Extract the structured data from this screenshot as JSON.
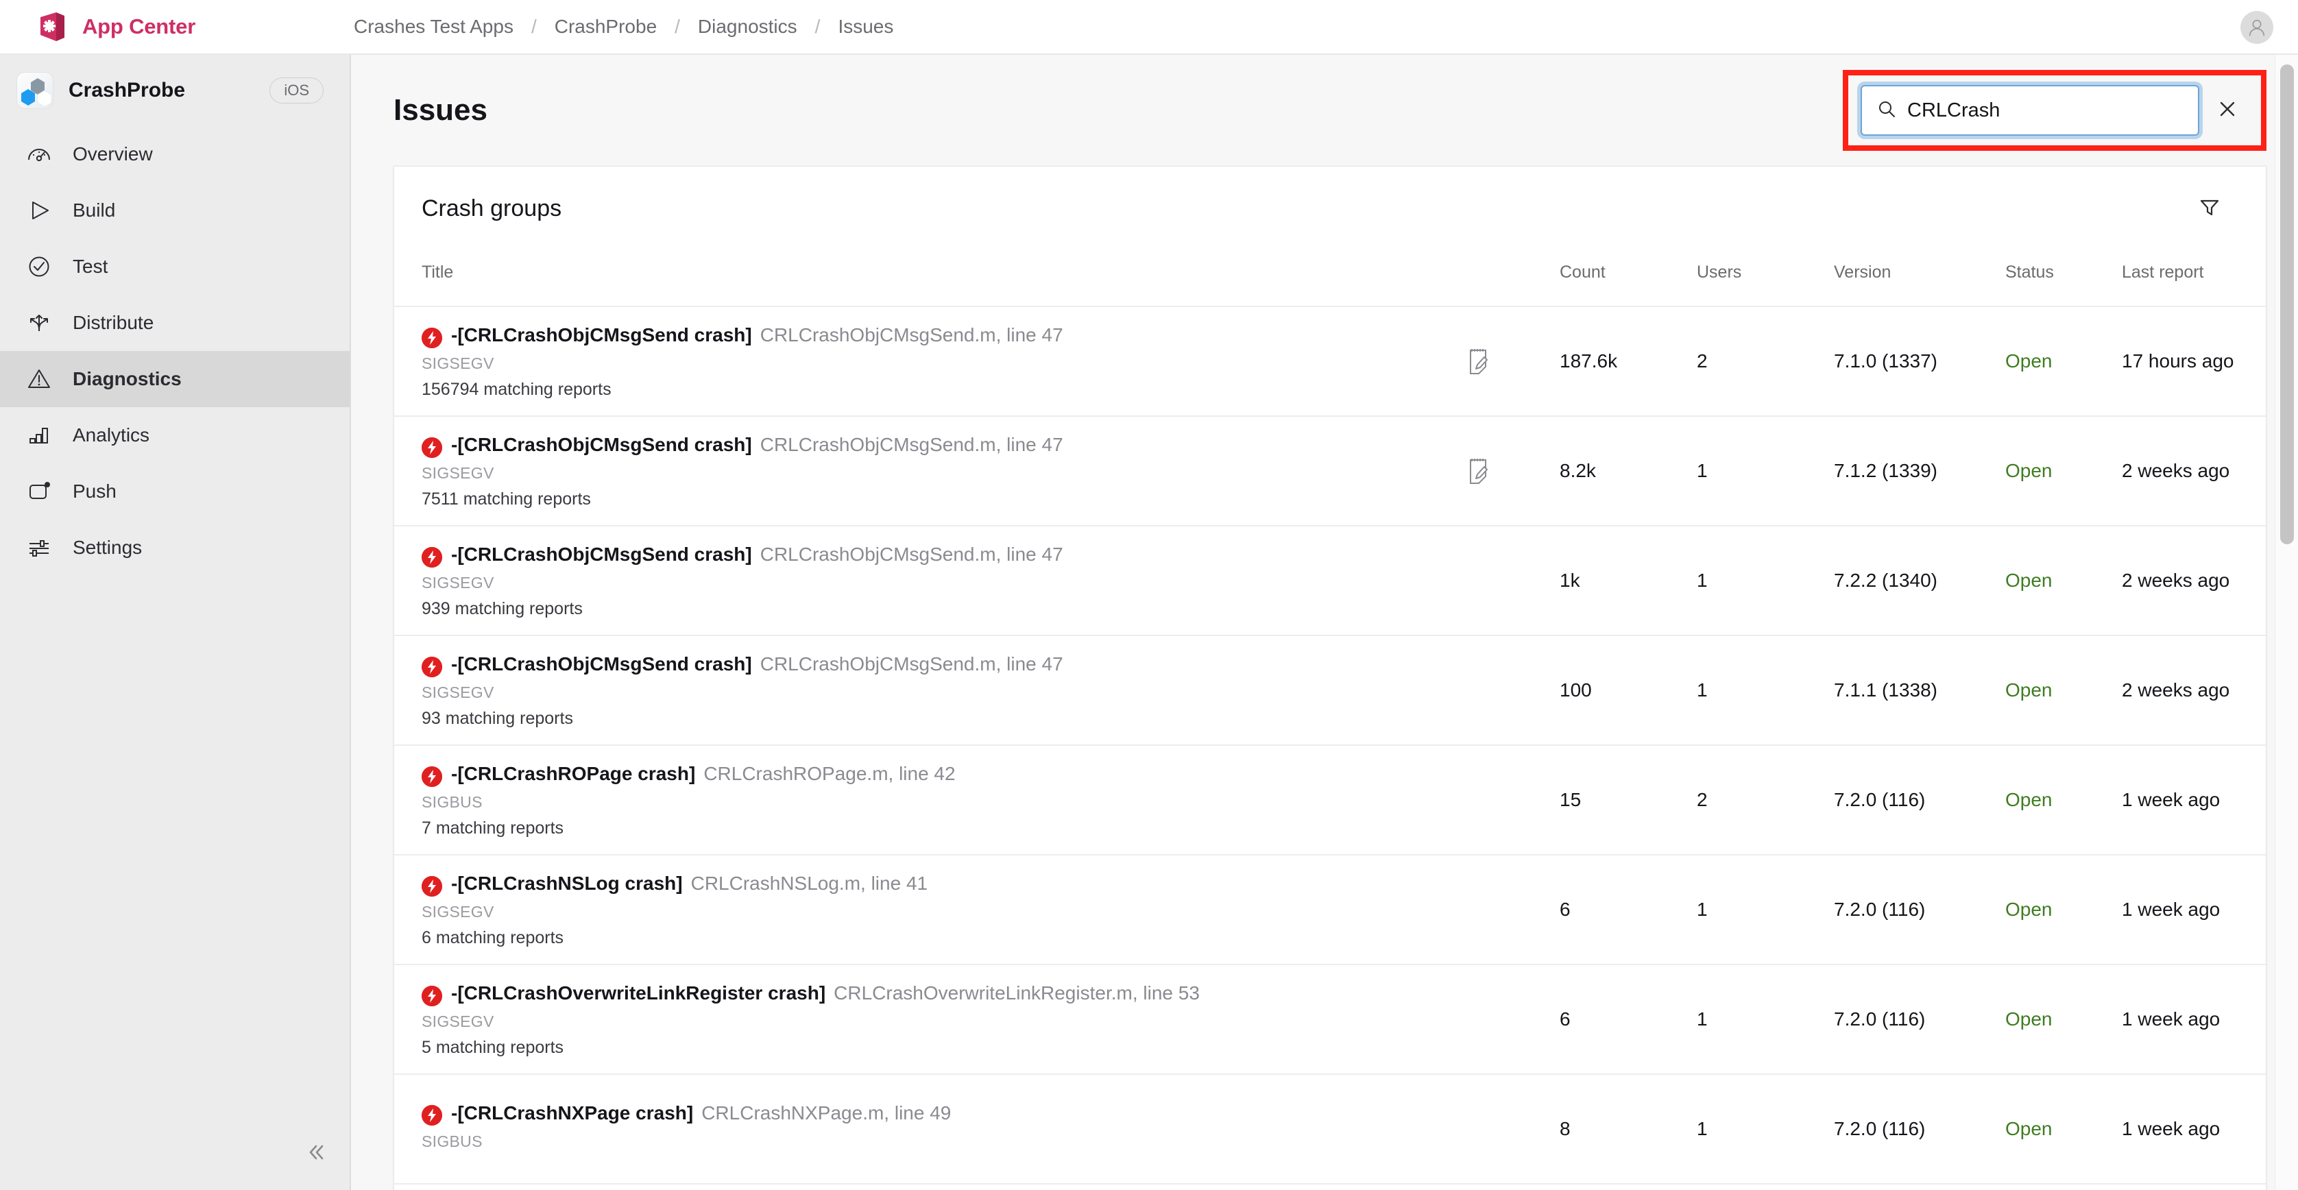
{
  "topbar": {
    "brand": "App Center",
    "brand_color": "#cf2e63",
    "logo_icon": "app-center-logo",
    "avatar_icon": "user-avatar-icon",
    "breadcrumb": [
      "Crashes Test Apps",
      "CrashProbe",
      "Diagnostics",
      "Issues"
    ],
    "breadcrumb_separator": "/"
  },
  "sidebar": {
    "app_name": "CrashProbe",
    "app_icon": "crashprobe-app-icon",
    "os_badge": "iOS",
    "collapse_icon": "chevron-double-left-icon",
    "items": [
      {
        "label": "Overview",
        "icon": "gauge-icon",
        "active": false
      },
      {
        "label": "Build",
        "icon": "play-icon",
        "active": false
      },
      {
        "label": "Test",
        "icon": "check-circle-icon",
        "active": false
      },
      {
        "label": "Distribute",
        "icon": "distribute-icon",
        "active": false
      },
      {
        "label": "Diagnostics",
        "icon": "warning-triangle-icon",
        "active": true
      },
      {
        "label": "Analytics",
        "icon": "bar-chart-icon",
        "active": false
      },
      {
        "label": "Push",
        "icon": "push-notification-icon",
        "active": false
      },
      {
        "label": "Settings",
        "icon": "sliders-icon",
        "active": false
      }
    ]
  },
  "page": {
    "title": "Issues",
    "highlight_color": "#ff2116"
  },
  "search": {
    "icon": "search-icon",
    "value": "CRLCrash",
    "placeholder": "Search",
    "clear_icon": "close-icon"
  },
  "card": {
    "title": "Crash groups",
    "filter_icon": "filter-funnel-icon",
    "columns": [
      "Title",
      "",
      "Count",
      "Users",
      "Version",
      "Status",
      "Last report"
    ],
    "note_icon": "note-edit-icon",
    "crash_icon": "crash-bolt-icon",
    "status_color": "#3f7d22",
    "rows": [
      {
        "title_main": "-[CRLCrashObjCMsgSend crash]",
        "title_file": "CRLCrashObjCMsgSend.m, line 47",
        "signal": "SIGSEGV",
        "matching": "156794 matching reports",
        "has_note": true,
        "count": "187.6k",
        "users": "2",
        "version": "7.1.0 (1337)",
        "status": "Open",
        "last_report": "17 hours ago"
      },
      {
        "title_main": "-[CRLCrashObjCMsgSend crash]",
        "title_file": "CRLCrashObjCMsgSend.m, line 47",
        "signal": "SIGSEGV",
        "matching": "7511 matching reports",
        "has_note": true,
        "count": "8.2k",
        "users": "1",
        "version": "7.1.2 (1339)",
        "status": "Open",
        "last_report": "2 weeks ago"
      },
      {
        "title_main": "-[CRLCrashObjCMsgSend crash]",
        "title_file": "CRLCrashObjCMsgSend.m, line 47",
        "signal": "SIGSEGV",
        "matching": "939 matching reports",
        "has_note": false,
        "count": "1k",
        "users": "1",
        "version": "7.2.2 (1340)",
        "status": "Open",
        "last_report": "2 weeks ago"
      },
      {
        "title_main": "-[CRLCrashObjCMsgSend crash]",
        "title_file": "CRLCrashObjCMsgSend.m, line 47",
        "signal": "SIGSEGV",
        "matching": "93 matching reports",
        "has_note": false,
        "count": "100",
        "users": "1",
        "version": "7.1.1 (1338)",
        "status": "Open",
        "last_report": "2 weeks ago"
      },
      {
        "title_main": "-[CRLCrashROPage crash]",
        "title_file": "CRLCrashROPage.m, line 42",
        "signal": "SIGBUS",
        "matching": "7 matching reports",
        "has_note": false,
        "count": "15",
        "users": "2",
        "version": "7.2.0 (116)",
        "status": "Open",
        "last_report": "1 week ago"
      },
      {
        "title_main": "-[CRLCrashNSLog crash]",
        "title_file": "CRLCrashNSLog.m, line 41",
        "signal": "SIGSEGV",
        "matching": "6 matching reports",
        "has_note": false,
        "count": "6",
        "users": "1",
        "version": "7.2.0 (116)",
        "status": "Open",
        "last_report": "1 week ago"
      },
      {
        "title_main": "-[CRLCrashOverwriteLinkRegister crash]",
        "title_file": "CRLCrashOverwriteLinkRegister.m, line 53",
        "signal": "SIGSEGV",
        "matching": "5 matching reports",
        "has_note": false,
        "count": "6",
        "users": "1",
        "version": "7.2.0 (116)",
        "status": "Open",
        "last_report": "1 week ago"
      },
      {
        "title_main": "-[CRLCrashNXPage crash]",
        "title_file": "CRLCrashNXPage.m, line 49",
        "signal": "SIGBUS",
        "matching": "",
        "has_note": false,
        "count": "8",
        "users": "1",
        "version": "7.2.0 (116)",
        "status": "Open",
        "last_report": "1 week ago"
      }
    ]
  },
  "scrollbar": {
    "icon": "vertical-scrollbar"
  }
}
